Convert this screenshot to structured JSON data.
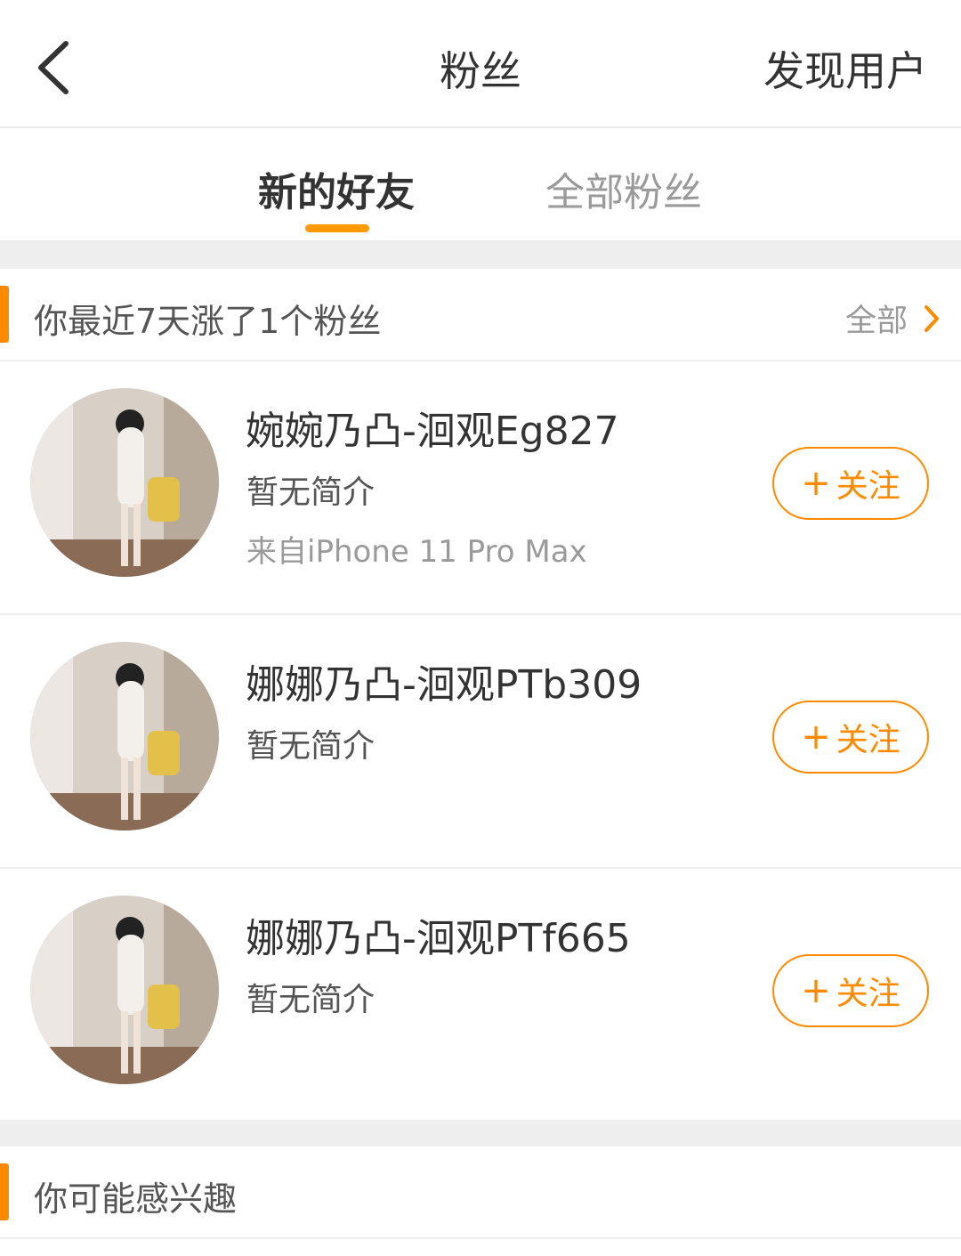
{
  "navbar": {
    "title": "粉丝",
    "right_action": "发现用户"
  },
  "tabs": [
    {
      "label": "新的好友",
      "active": true
    },
    {
      "label": "全部粉丝",
      "active": false
    }
  ],
  "section_new": {
    "title": "你最近7天涨了1个粉丝",
    "more_label": "全部"
  },
  "users": [
    {
      "name": "婉婉乃凸-洄观Eg827",
      "bio": "暂无简介",
      "device": "来自iPhone 11 Pro Max",
      "follow_label": "关注"
    },
    {
      "name": "娜娜乃凸-洄观PTb309",
      "bio": "暂无简介",
      "follow_label": "关注"
    },
    {
      "name": "娜娜乃凸-洄观PTf665",
      "bio": "暂无简介",
      "follow_label": "关注"
    }
  ],
  "section_interest": {
    "title": "你可能感兴趣"
  },
  "colors": {
    "accent": "#ff8a00",
    "divider": "#eeeeee",
    "muted_text": "#9a9a9a"
  }
}
